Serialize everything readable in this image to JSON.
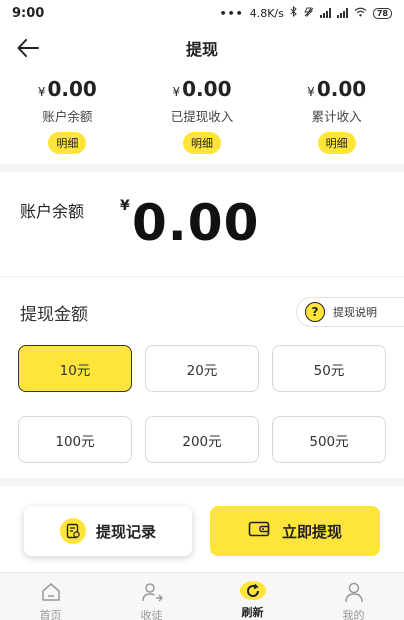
{
  "status_bar": {
    "time": "9:00",
    "dots": "•••",
    "network_speed": "4.8K/s",
    "battery": "78"
  },
  "header": {
    "title": "提现",
    "back_icon": "arrow-left-icon"
  },
  "summary": [
    {
      "currency": "¥",
      "value": "0.00",
      "label": "账户余额",
      "detail_label": "明细"
    },
    {
      "currency": "¥",
      "value": "0.00",
      "label": "已提现收入",
      "detail_label": "明细"
    },
    {
      "currency": "¥",
      "value": "0.00",
      "label": "累计收入",
      "detail_label": "明细"
    }
  ],
  "balance": {
    "label": "账户余额",
    "currency": "¥",
    "amount": "0.00"
  },
  "withdraw": {
    "title": "提现金额",
    "help_label": "提现说明",
    "help_icon_glyph": "?",
    "amounts": [
      "10元",
      "20元",
      "50元",
      "100元",
      "200元",
      "500元"
    ],
    "selected_index": 0
  },
  "actions": {
    "record_label": "提现记录",
    "withdraw_label": "立即提现"
  },
  "tabbar": {
    "items": [
      {
        "label": "首页",
        "icon": "home-icon",
        "active": false
      },
      {
        "label": "收徒",
        "icon": "add-user-icon",
        "active": false
      },
      {
        "label": "刷新",
        "icon": "refresh-icon",
        "active": true
      },
      {
        "label": "我的",
        "icon": "profile-icon",
        "active": false
      }
    ]
  },
  "colors": {
    "accent": "#FFE43A",
    "text": "#222222",
    "muted": "#999999",
    "border": "#d7d7d7"
  }
}
